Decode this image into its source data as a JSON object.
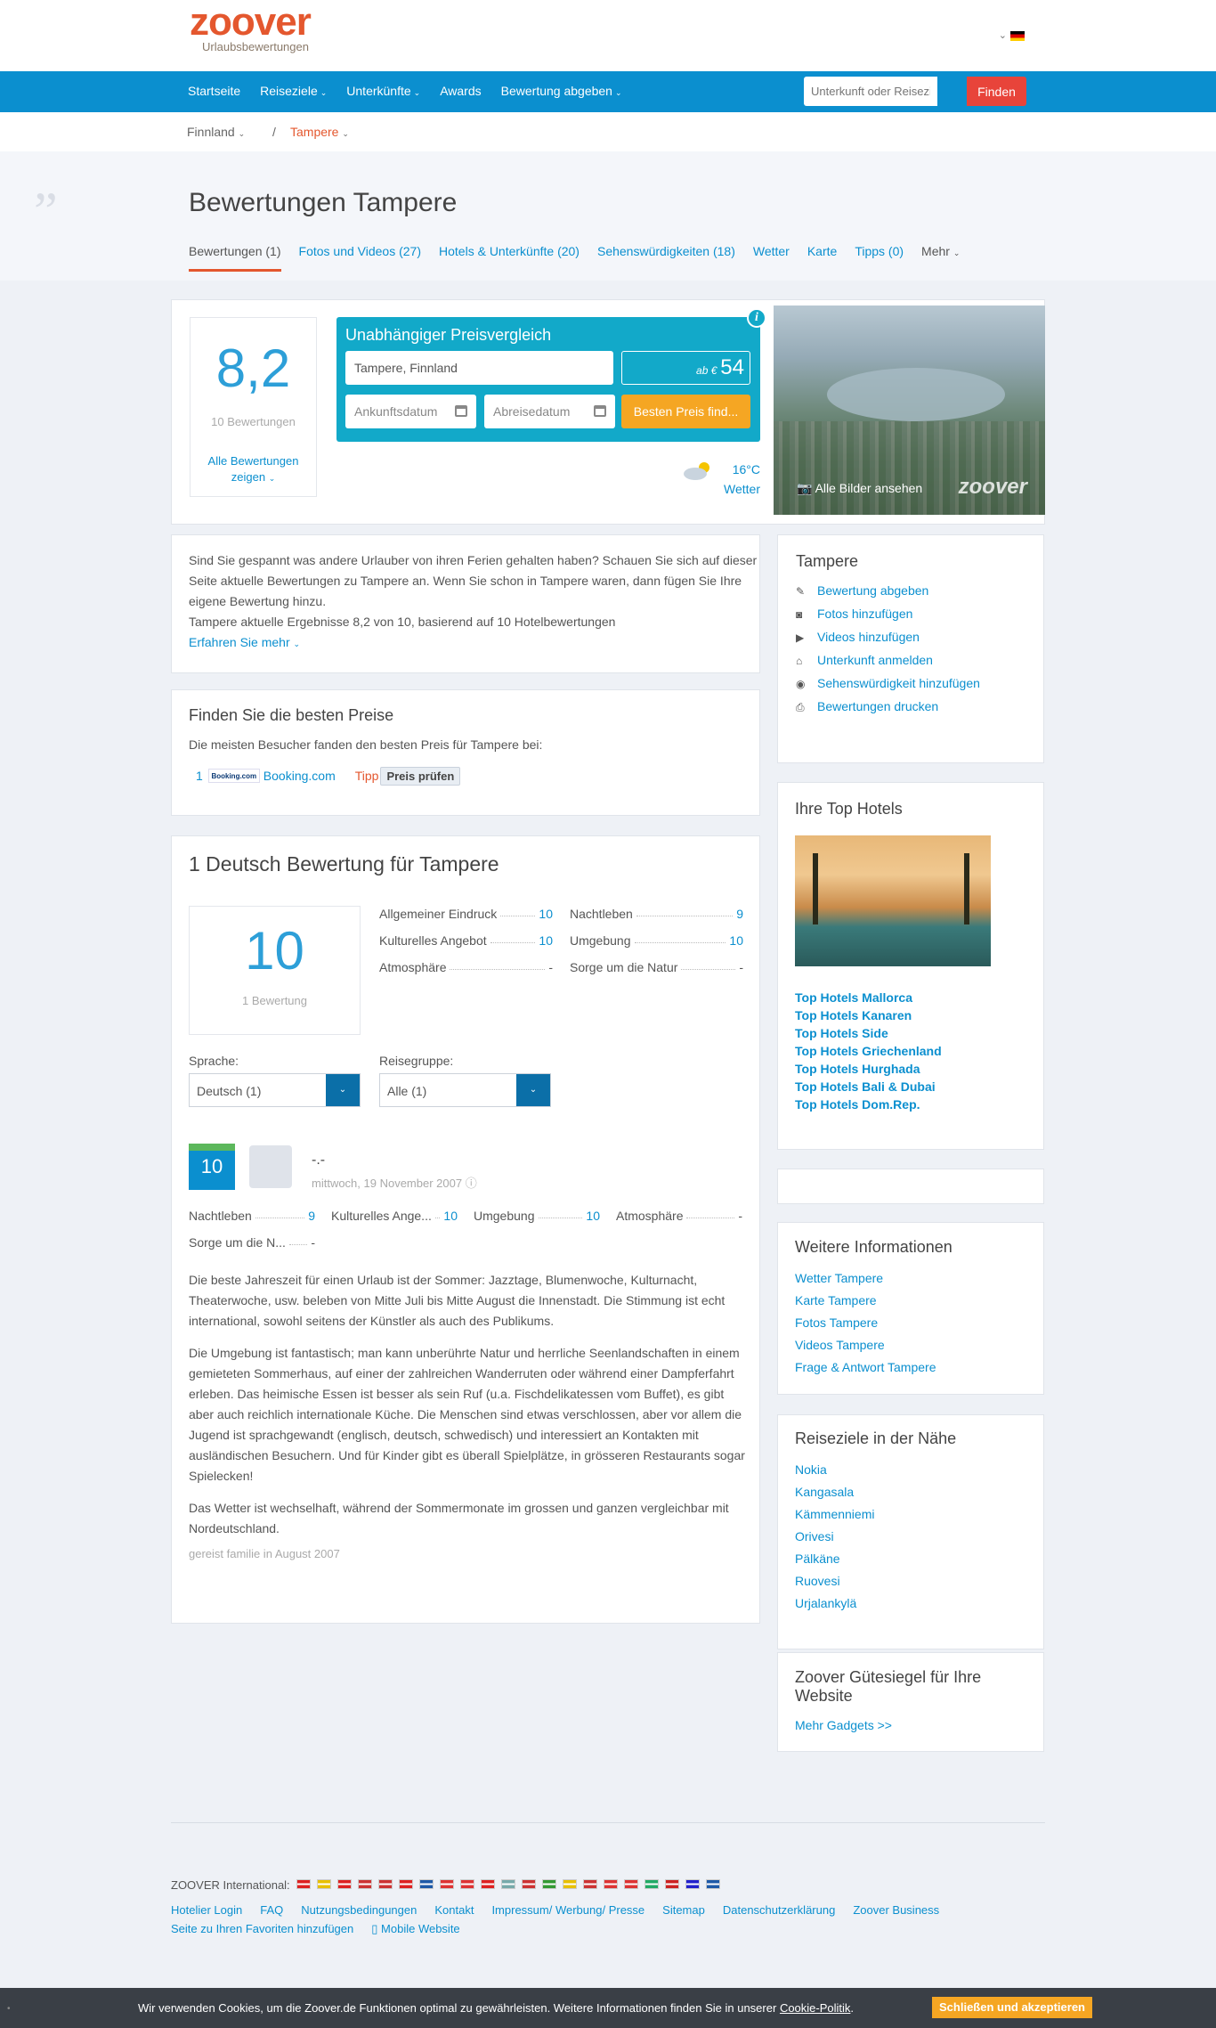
{
  "header": {
    "logo_brand": "zoover",
    "logo_tagline": "Urlaubsbewertungen"
  },
  "nav": {
    "items": [
      "Startseite",
      "Reiseziele",
      "Unterkünfte",
      "Awards",
      "Bewertung abgeben"
    ],
    "search_placeholder": "Unterkunft oder Reiseziel",
    "search_button": "Finden"
  },
  "breadcrumb": {
    "country": "Finnland",
    "separator": "/",
    "city": "Tampere"
  },
  "hero": {
    "title": "Bewertungen Tampere"
  },
  "tabs": [
    "Bewertungen (1)",
    "Fotos und Videos (27)",
    "Hotels & Unterkünfte (20)",
    "Sehenswürdigkeiten (18)",
    "Wetter",
    "Karte",
    "Tipps (0)",
    "Mehr"
  ],
  "score": {
    "value": "8,2",
    "count": "10 Bewertungen",
    "all_link": "Alle Bewertungen zeigen"
  },
  "price_compare": {
    "title": "Unabhängiger Preisvergleich",
    "destination": "Tampere, Finnland",
    "ab_label": "ab €",
    "price": "54",
    "arrival": "Ankunftsdatum",
    "departure": "Abreisedatum",
    "button": "Besten Preis find..."
  },
  "weather": {
    "temp": "16°C",
    "label": "Wetter"
  },
  "photo": {
    "link": "Alle Bilder ansehen",
    "watermark": "zoover"
  },
  "intro": {
    "text": "Sind Sie gespannt was andere Urlauber von ihren Ferien gehalten haben? Schauen Sie sich auf dieser Seite aktuelle Bewertungen zu Tampere an. Wenn Sie schon in Tampere waren, dann fügen Sie Ihre eigene Bewertung hinzu.",
    "result": "Tampere aktuelle Ergebnisse 8,2 von 10, basierend auf 10 Hotelbewertungen",
    "more": "Erfahren Sie mehr"
  },
  "sidebar": {
    "title": "Tampere",
    "items": [
      {
        "icon": "pencil-icon",
        "label": "Bewertung abgeben"
      },
      {
        "icon": "camera-icon",
        "label": "Fotos hinzufügen"
      },
      {
        "icon": "video-icon",
        "label": "Videos hinzufügen"
      },
      {
        "icon": "home-icon",
        "label": "Unterkunft anmelden"
      },
      {
        "icon": "eye-icon",
        "label": "Sehenswürdigkeit hinzufügen"
      },
      {
        "icon": "print-icon",
        "label": "Bewertungen drucken"
      }
    ]
  },
  "best_prices": {
    "title": "Finden Sie die besten Preise",
    "subtitle": "Die meisten Besucher fanden den besten Preis für Tampere bei:",
    "rank": "1",
    "logo_text": "Booking.com",
    "provider": "Booking.com",
    "tipp": "Tipp",
    "check": "Preis prüfen"
  },
  "reviews": {
    "title": "1 Deutsch Bewertung für Tampere",
    "score": "10",
    "count": "1 Bewertung",
    "ratings": [
      {
        "label": "Allgemeiner Eindruck",
        "value": "10"
      },
      {
        "label": "Nachtleben",
        "value": "9"
      },
      {
        "label": "Kulturelles Angebot",
        "value": "10"
      },
      {
        "label": "Umgebung",
        "value": "10"
      },
      {
        "label": "Atmosphäre",
        "value": "-"
      },
      {
        "label": "Sorge um die Natur",
        "value": "-"
      }
    ],
    "lang_label": "Sprache:",
    "lang_value": "Deutsch (1)",
    "group_label": "Reisegruppe:",
    "group_value": "Alle (1)"
  },
  "review": {
    "score": "10",
    "name": "-.-",
    "date": "mittwoch, 19 November 2007",
    "ratings": [
      {
        "label": "Nachtleben",
        "value": "9"
      },
      {
        "label": "Kulturelles Ange...",
        "value": "10"
      },
      {
        "label": "Umgebung",
        "value": "10"
      },
      {
        "label": "Atmosphäre",
        "value": "-"
      },
      {
        "label": "Sorge um die N...",
        "value": "-"
      }
    ],
    "p1": "Die beste Jahreszeit für einen Urlaub ist der Sommer: Jazztage, Blumenwoche, Kulturnacht, Theaterwoche, usw. beleben von Mitte Juli bis Mitte August die Innenstadt. Die Stimmung ist echt international, sowohl seitens der Künstler als auch des Publikums.",
    "p2": "Die Umgebung ist fantastisch; man kann unberührte Natur und herrliche Seenlandschaften in einem gemieteten Sommerhaus, auf einer der zahlreichen Wanderruten oder während einer Dampferfahrt erleben. Das heimische Essen ist besser als sein Ruf (u.a. Fischdelikatessen vom Buffet), es gibt aber auch reichlich internationale Küche. Die Menschen sind etwas verschlossen, aber vor allem die Jugend ist sprachgewandt (englisch, deutsch, schwedisch) und interessiert an Kontakten mit ausländischen Besuchern. Und für Kinder gibt es überall Spielplätze, in grösseren Restaurants sogar Spielecken!",
    "p3": "Das Wetter ist wechselhaft, während der Sommermonate im grossen und ganzen vergleichbar mit Nordeutschland.",
    "gereist": "gereist familie in August 2007"
  },
  "top_hotels": {
    "title": "Ihre Top Hotels",
    "links": [
      "Top Hotels Mallorca",
      "Top Hotels Kanaren",
      "Top Hotels Side",
      "Top Hotels Griechenland",
      "Top Hotels Hurghada",
      "Top Hotels Bali & Dubai",
      "Top Hotels Dom.Rep."
    ]
  },
  "weitere": {
    "title": "Weitere Informationen",
    "links": [
      "Wetter Tampere",
      "Karte Tampere",
      "Fotos Tampere",
      "Videos Tampere",
      "Frage & Antwort Tampere"
    ]
  },
  "naehe": {
    "title": "Reiseziele in der Nähe",
    "links": [
      "Nokia",
      "Kangasala",
      "Kämmenniemi",
      "Orivesi",
      "Pälkäne",
      "Ruovesi",
      "Urjalankylä"
    ]
  },
  "guete": {
    "title": "Zoover Gütesiegel für Ihre Website",
    "link": "Mehr Gadgets >>"
  },
  "footer": {
    "intl_label": "ZOOVER International:",
    "flag_colors": [
      "#d22",
      "#e8c000",
      "#d22",
      "#c33",
      "#c33",
      "#d22",
      "#1e5aa8",
      "#d33",
      "#d33",
      "#d22",
      "#7aa",
      "#c33",
      "#393",
      "#e8c000",
      "#c33",
      "#d33",
      "#d33",
      "#2a6",
      "#c22",
      "#22c",
      "#1e5aa8"
    ],
    "links": [
      "Hotelier Login",
      "FAQ",
      "Nutzungsbedingungen",
      "Kontakt",
      "Impressum/ Werbung/ Presse",
      "Sitemap",
      "Datenschutzerklärung",
      "Zoover Business",
      "Seite zu Ihren Favoriten hinzufügen",
      "Mobile Website"
    ]
  },
  "cookie": {
    "text": "Wir verwenden Cookies, um die Zoover.de Funktionen optimal zu gewährleisten. Weitere Informationen finden Sie in unserer",
    "link": "Cookie-Politik",
    "button": "Schließen und akzeptieren"
  }
}
